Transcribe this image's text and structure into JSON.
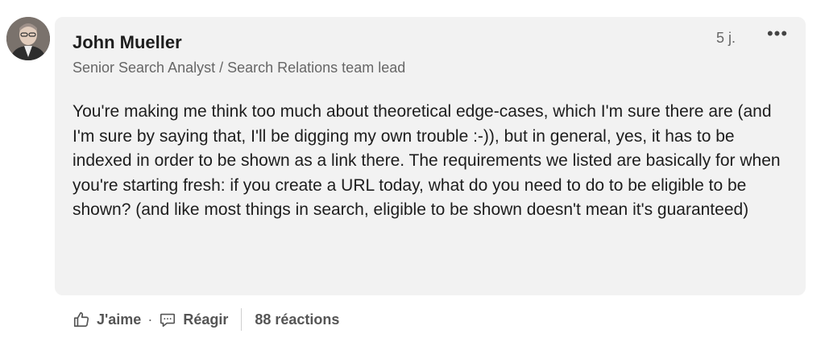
{
  "comment": {
    "author_name": "John Mueller",
    "author_headline": "Senior Search Analyst / Search Relations team lead",
    "timestamp": "5 j.",
    "more_label": "•••",
    "text": "You're making me think too much about theoretical edge-cases, which I'm sure there are (and I'm sure by saying that, I'll be digging my own trouble :-)), but in general, yes, it has to be indexed in order to be shown as a link there. The requirements we listed are basically for when you're starting fresh: if you create a URL today, what do you need to do to be eligible to be shown? (and like most things in search, eligible to be shown doesn't mean it's guaranteed)"
  },
  "actions": {
    "like_label": "J'aime",
    "dot": "·",
    "reply_label": "Réagir",
    "reactions_label": "88 réactions"
  },
  "icons": {
    "like": "thumbs-up-icon",
    "reply": "comment-icon",
    "more": "ellipsis-icon"
  },
  "colors": {
    "bubble": "#f2f2f2",
    "secondary_text": "#666666"
  }
}
